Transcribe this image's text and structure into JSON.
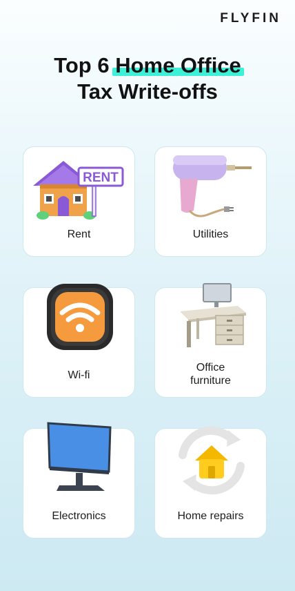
{
  "brand": {
    "logo_text": "FLYFIN"
  },
  "title": {
    "prefix": "Top 6 ",
    "highlight": "Home Office",
    "line2": "Tax Write-offs"
  },
  "highlight_color": "#3ff0d8",
  "cards": [
    {
      "label": "Rent",
      "icon": "rent-house-icon"
    },
    {
      "label": "Utilities",
      "icon": "power-drill-icon"
    },
    {
      "label": "Wi-fi",
      "icon": "wifi-icon"
    },
    {
      "label_line1": "Office",
      "label_line2": "furniture",
      "icon": "office-desk-icon"
    },
    {
      "label": "Electronics",
      "icon": "computer-monitor-icon"
    },
    {
      "label": "Home repairs",
      "icon": "home-repair-icon"
    }
  ],
  "rent_sign_text": "RENT"
}
